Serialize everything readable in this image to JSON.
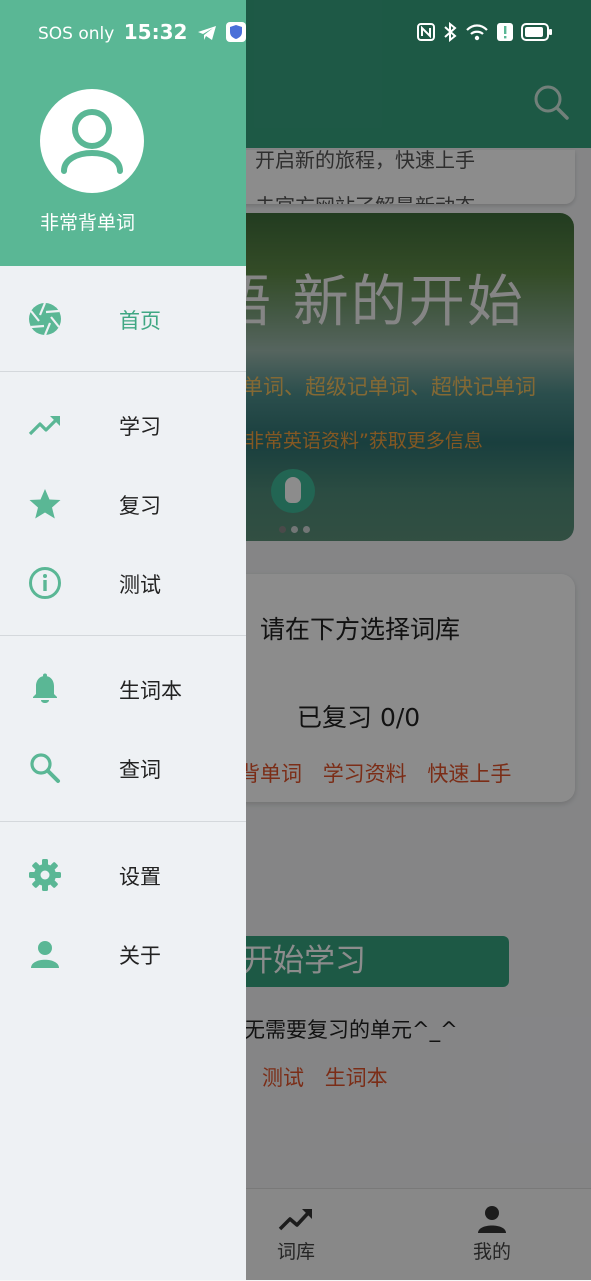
{
  "status_bar": {
    "left_text": "SOS only",
    "time": "15:32"
  },
  "drawer": {
    "app_name": "非常背单词",
    "groups": [
      [
        {
          "label": "首页",
          "icon": "aperture-icon",
          "active": true
        }
      ],
      [
        {
          "label": "学习",
          "icon": "trending-up-icon"
        },
        {
          "label": "复习",
          "icon": "star-icon"
        },
        {
          "label": "测试",
          "icon": "info-icon"
        }
      ],
      [
        {
          "label": "生词本",
          "icon": "bell-icon"
        },
        {
          "label": "查词",
          "icon": "search-icon"
        }
      ],
      [
        {
          "label": "设置",
          "icon": "gear-icon"
        },
        {
          "label": "关于",
          "icon": "person-icon"
        }
      ]
    ]
  },
  "background": {
    "notice_lines": [
      "开启新的旅程，快速上手",
      "去官方网站了解最新动态"
    ],
    "banner": {
      "title": "语  新的开始",
      "subtitle1": "背单词、超级记单词、超快记单词",
      "subtitle2": "非常英语资料”获取更多信息"
    },
    "library_card": {
      "prompt": "请在下方选择词库",
      "review_status": "已复习 0/0",
      "links": [
        "背单词",
        "学习资料",
        "快速上手"
      ]
    },
    "start_button": "开始学习",
    "no_review_text": "无需要复习的单元^_^",
    "bottom_links": [
      "测试",
      "生词本"
    ],
    "bottom_nav": [
      {
        "label": "词库",
        "icon": "trending-up-icon"
      },
      {
        "label": "我的",
        "icon": "person-icon"
      }
    ]
  },
  "colors": {
    "primary": "#36a27f",
    "drawer_header": "#5ab795",
    "accent_text": "#e0532a"
  }
}
